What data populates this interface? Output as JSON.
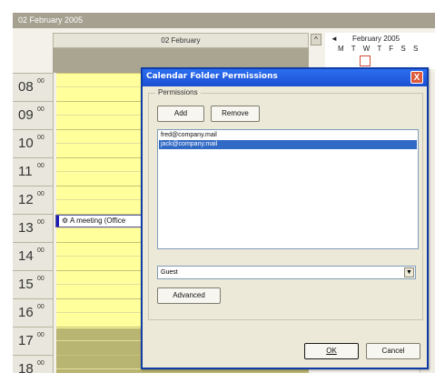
{
  "calendar": {
    "date_title": "02 February 2005",
    "day_header": "02 February",
    "hours": [
      "08",
      "09",
      "10",
      "11",
      "12",
      "13",
      "14",
      "15",
      "16",
      "17",
      "18"
    ],
    "minutes_label": "00",
    "meeting_label": "A meeting (Office",
    "mini_calendar": {
      "prev_glyph": "◄",
      "month_label": "February 2005",
      "weekdays": "M T W T F S S"
    },
    "scroll_glyph": "^"
  },
  "dialog": {
    "title": "Calendar Folder Permissions",
    "close_glyph": "X",
    "group_label": "Permissions",
    "add_label": "Add",
    "remove_label": "Remove",
    "users": [
      {
        "email": "fred@company.mail",
        "selected": false
      },
      {
        "email": "jack@company.mail",
        "selected": true
      }
    ],
    "role_value": "Guest",
    "dropdown_glyph": "▼",
    "advanced_label": "Advanced",
    "ok_label": "OK",
    "cancel_label": "Cancel"
  },
  "colors": {
    "title_bar": "#1b4fd2",
    "selection": "#316ac5",
    "calendar_body": "#ffff9c",
    "header_bar": "#a5a08f"
  }
}
